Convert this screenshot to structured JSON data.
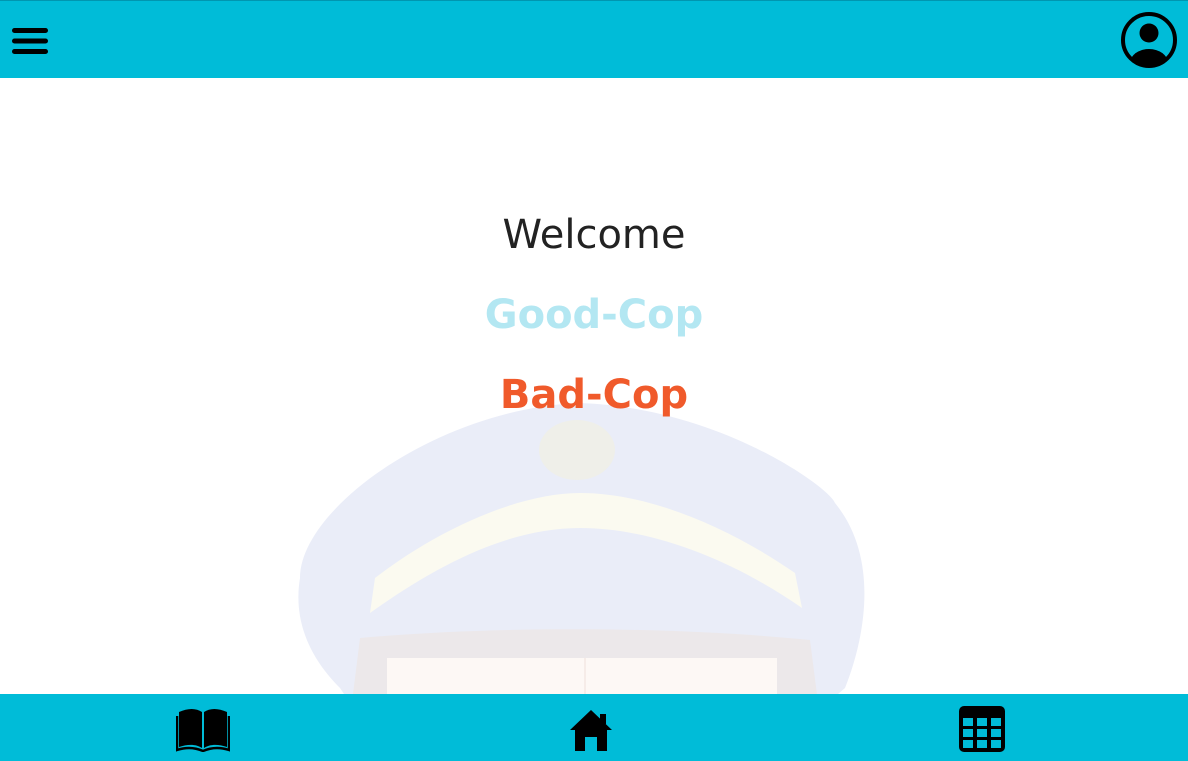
{
  "header": {
    "menu_icon": "hamburger-menu-icon",
    "profile_icon": "user-circle-icon"
  },
  "main": {
    "welcome_text": "Welcome",
    "roles": [
      {
        "label": "Good-Cop",
        "color": "#b3e7f2"
      },
      {
        "label": "Bad-Cop",
        "color": "#f05a2b"
      }
    ],
    "background_image": "police-hat-watermark"
  },
  "bottom_nav": {
    "items": [
      {
        "icon": "open-book-icon"
      },
      {
        "icon": "home-icon"
      },
      {
        "icon": "calendar-grid-icon"
      }
    ]
  },
  "colors": {
    "bar_background": "#00bcd8",
    "page_background": "#ffffff"
  }
}
